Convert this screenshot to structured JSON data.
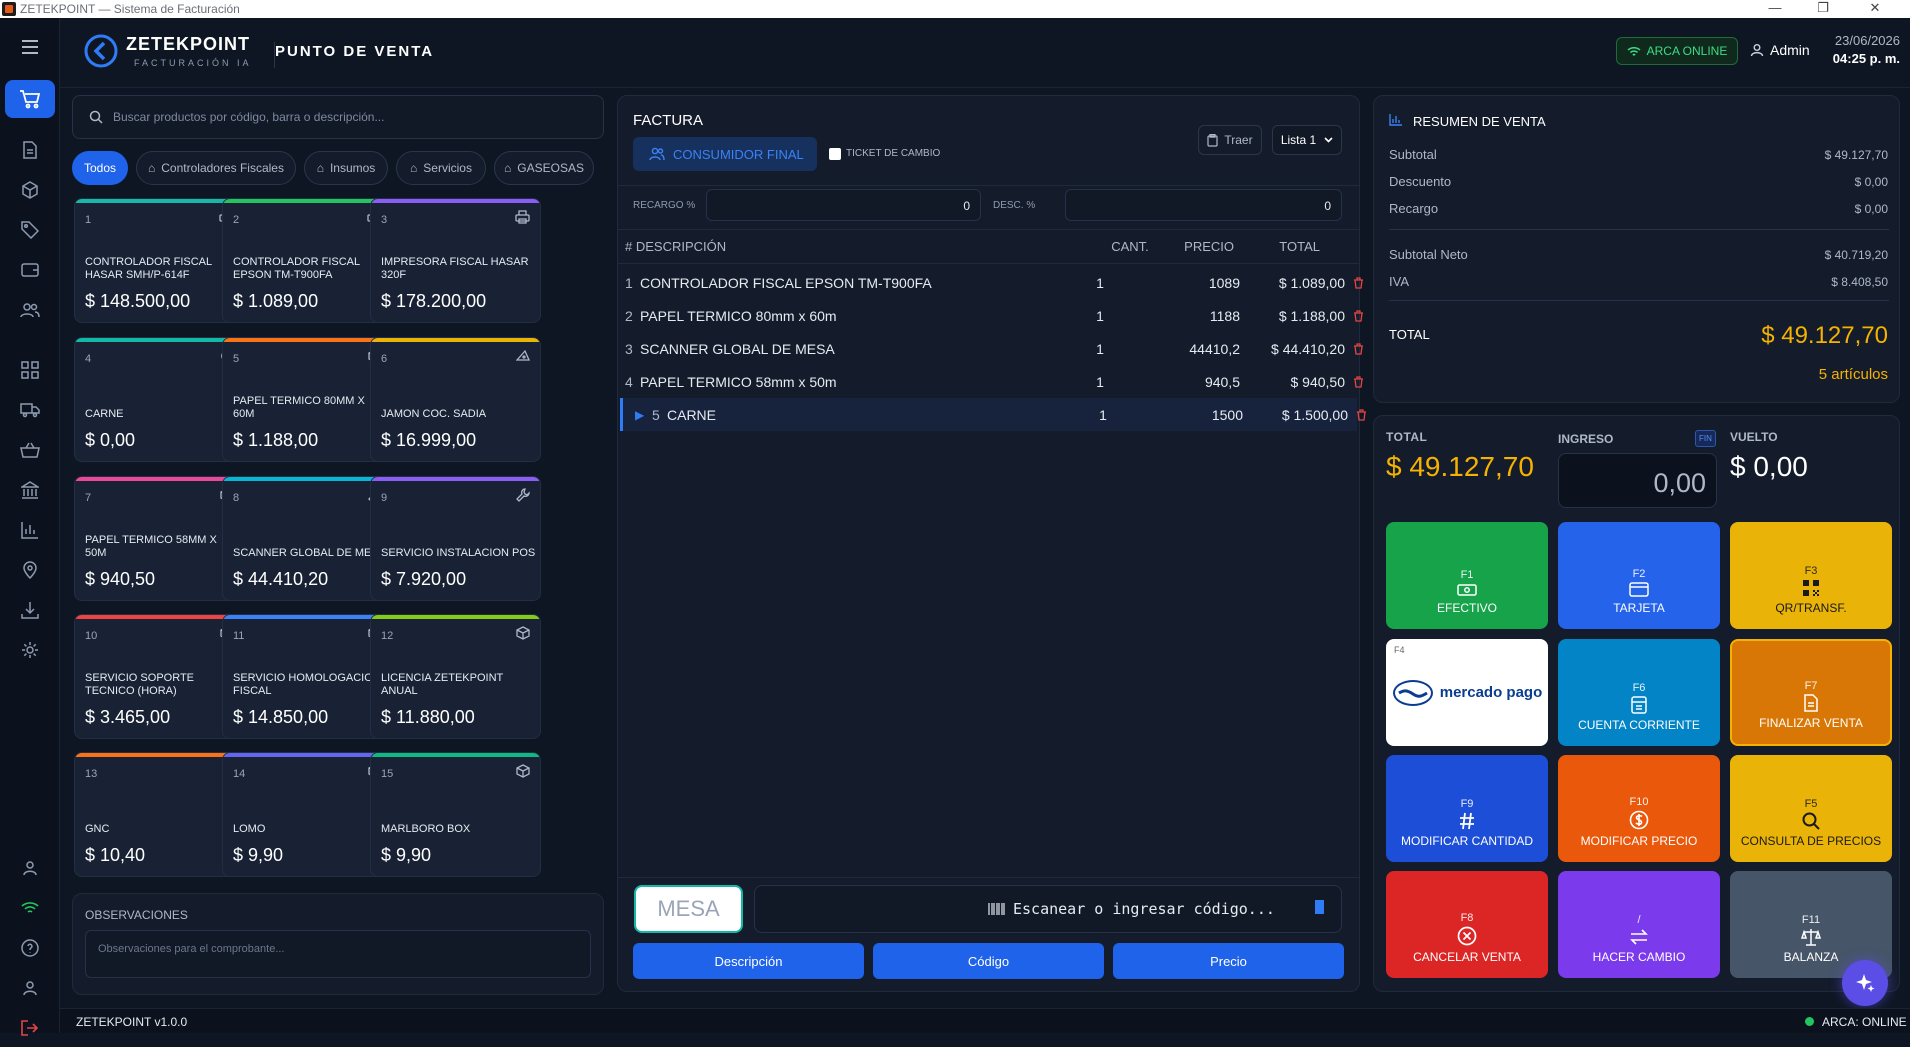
{
  "window": {
    "title": "ZETEKPOINT — Sistema de Facturación"
  },
  "brand": {
    "name": "ZETEKPOINT",
    "tagline": "FACTURACIÓN IA"
  },
  "header": {
    "section_title": "PUNTO DE VENTA",
    "arca_status": "ARCA ONLINE",
    "user": "Admin",
    "date": "23/06/2026",
    "time": "04:25 p. m."
  },
  "catalog": {
    "search_placeholder": "Buscar productos por código, barra o descripción...",
    "chips": [
      "Todos",
      "Controladores Fiscales",
      "Insumos",
      "Servicios",
      "GASEOSAS"
    ],
    "products": [
      {
        "n": "1",
        "name": "CONTROLADOR FISCAL HASAR SMH/P-614F",
        "price": "$ 148.500,00",
        "color": "#18b8a6",
        "icon": "printer-icon"
      },
      {
        "n": "2",
        "name": "CONTROLADOR FISCAL EPSON TM-T900FA",
        "price": "$ 1.089,00",
        "color": "#22c55e",
        "icon": "printer-icon"
      },
      {
        "n": "3",
        "name": "IMPRESORA FISCAL HASAR 320F",
        "price": "$ 178.200,00",
        "color": "#8b5cf6",
        "icon": "printer-icon"
      },
      {
        "n": "4",
        "name": "CARNE",
        "price": "$ 0,00",
        "color": "#14b8a6",
        "icon": "steak-icon"
      },
      {
        "n": "5",
        "name": "PAPEL TERMICO 80MM X 60M",
        "price": "$ 1.188,00",
        "color": "#f97316",
        "icon": "box-icon"
      },
      {
        "n": "6",
        "name": "JAMON COC. SADIA",
        "price": "$ 16.999,00",
        "color": "#eab308",
        "icon": "cheese-icon"
      },
      {
        "n": "7",
        "name": "PAPEL TERMICO 58MM X 50M",
        "price": "$ 940,50",
        "color": "#ec4899",
        "icon": "box-icon"
      },
      {
        "n": "8",
        "name": "SCANNER GLOBAL DE MESA",
        "price": "$ 44.410,20",
        "color": "#06b6d4",
        "icon": "wrench-icon"
      },
      {
        "n": "9",
        "name": "SERVICIO INSTALACION POS",
        "price": "$ 7.920,00",
        "color": "#8b5cf6",
        "icon": "wrench-icon"
      },
      {
        "n": "10",
        "name": "SERVICIO SOPORTE TECNICO (HORA)",
        "price": "$ 3.465,00",
        "color": "#ef4444",
        "icon": "box-icon"
      },
      {
        "n": "11",
        "name": "SERVICIO HOMOLOGACION FISCAL",
        "price": "$ 14.850,00",
        "color": "#3b82f6",
        "icon": "box-icon"
      },
      {
        "n": "12",
        "name": "LICENCIA ZETEKPOINT ANUAL",
        "price": "$ 11.880,00",
        "color": "#84cc16",
        "icon": "box-icon"
      },
      {
        "n": "13",
        "name": "GNC",
        "price": "$ 10,40",
        "color": "#f97316",
        "icon": "drop-icon"
      },
      {
        "n": "14",
        "name": "LOMO",
        "price": "$ 9,90",
        "color": "#6366f1",
        "icon": "box-icon"
      },
      {
        "n": "15",
        "name": "MARLBORO BOX",
        "price": "$ 9,90",
        "color": "#10b981",
        "icon": "box-icon"
      }
    ],
    "observations_label": "OBSERVACIONES",
    "observations_placeholder": "Observaciones para el comprobante..."
  },
  "invoice": {
    "title": "FACTURA",
    "customer": "CONSUMIDOR FINAL",
    "ticket_label": "TICKET DE CAMBIO",
    "traer": "Traer",
    "list_select": "Lista 1",
    "recargo_label": "RECARGO %",
    "recargo_value": "0",
    "desc_label": "DESC. %",
    "desc_value": "0",
    "columns": {
      "desc": "# DESCRIPCIÓN",
      "cant": "CANT.",
      "precio": "PRECIO",
      "total": "TOTAL"
    },
    "rows": [
      {
        "i": "1",
        "desc": "CONTROLADOR FISCAL EPSON TM-T900FA",
        "cant": "1",
        "precio": "1089",
        "total": "$ 1.089,00"
      },
      {
        "i": "2",
        "desc": "PAPEL TERMICO 80mm x 60m",
        "cant": "1",
        "precio": "1188",
        "total": "$ 1.188,00"
      },
      {
        "i": "3",
        "desc": "SCANNER GLOBAL DE MESA",
        "cant": "1",
        "precio": "44410,2",
        "total": "$ 44.410,20"
      },
      {
        "i": "4",
        "desc": "PAPEL TERMICO 58mm x 50m",
        "cant": "1",
        "precio": "940,5",
        "total": "$ 940,50"
      },
      {
        "i": "5",
        "desc": "CARNE",
        "cant": "1",
        "precio": "1500",
        "total": "$ 1.500,00"
      }
    ],
    "mesa_label": "MESA",
    "scan_placeholder": "Escanear o ingresar código...",
    "btn_desc": "Descripción",
    "btn_codigo": "Código",
    "btn_precio": "Precio"
  },
  "summary": {
    "title": "RESUMEN DE VENTA",
    "subtotal_label": "Subtotal",
    "subtotal": "$ 49.127,70",
    "descuento_label": "Descuento",
    "descuento": "$ 0,00",
    "recargo_label": "Recargo",
    "recargo": "$ 0,00",
    "neto_label": "Subtotal Neto",
    "neto": "$ 40.719,20",
    "iva_label": "IVA",
    "iva": "$ 8.408,50",
    "total_label": "TOTAL",
    "total": "$ 49.127,70",
    "articulos": "5 artículos"
  },
  "payment": {
    "total_label": "TOTAL",
    "total": "$ 49.127,70",
    "ingreso_label": "INGRESO",
    "ingreso": "0,00",
    "fin": "FIN",
    "vuelto_label": "VUELTO",
    "vuelto": "$ 0,00",
    "buttons": [
      {
        "key": "F1",
        "label": "EFECTIVO",
        "color": "#16a34a",
        "icon": "cash-icon"
      },
      {
        "key": "F2",
        "label": "TARJETA",
        "color": "#2563eb",
        "icon": "card-icon"
      },
      {
        "key": "F3",
        "label": "QR/TRANSF.",
        "color": "#eab308",
        "icon": "qr-icon"
      },
      {
        "key": "F4",
        "label": "mercado pago",
        "color": "#ffffff",
        "icon": "mercadopago-logo"
      },
      {
        "key": "F6",
        "label": "CUENTA CORRIENTE",
        "color": "#0284c7",
        "icon": "ledger-icon"
      },
      {
        "key": "F7",
        "label": "FINALIZAR VENTA",
        "color": "#d97706",
        "icon": "receipt-icon"
      },
      {
        "key": "F9",
        "label": "MODIFICAR CANTIDAD",
        "color": "#1d4ed8",
        "icon": "hash-icon"
      },
      {
        "key": "F10",
        "label": "MODIFICAR PRECIO",
        "color": "#ea580c",
        "icon": "dollar-icon"
      },
      {
        "key": "F5",
        "label": "CONSULTA DE PRECIOS",
        "color": "#eab308",
        "icon": "search-icon"
      },
      {
        "key": "F8",
        "label": "CANCELAR VENTA",
        "color": "#dc2626",
        "icon": "cancel-icon"
      },
      {
        "key": "/",
        "label": "HACER CAMBIO",
        "color": "#7c3aed",
        "icon": "swap-icon"
      },
      {
        "key": "F11",
        "label": "BALANZA",
        "color": "#475569",
        "icon": "scale-icon"
      }
    ]
  },
  "status": {
    "version": "ZETEKPOINT v1.0.0",
    "arca": "ARCA: ONLINE"
  }
}
